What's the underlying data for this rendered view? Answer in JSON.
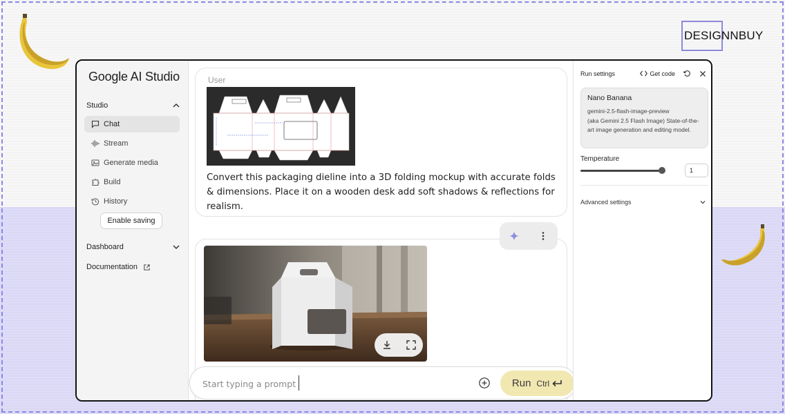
{
  "brand": {
    "label": "DESIGNNBUY"
  },
  "app": {
    "logo": "Google AI Studio"
  },
  "sidebar": {
    "studio_label": "Studio",
    "items": [
      {
        "label": "Chat",
        "icon": "chat-icon",
        "active": true
      },
      {
        "label": "Stream",
        "icon": "waveform-icon"
      },
      {
        "label": "Generate media",
        "icon": "media-icon"
      },
      {
        "label": "Build",
        "icon": "puzzle-icon"
      },
      {
        "label": "History",
        "icon": "history-icon"
      }
    ],
    "enable_saving": "Enable saving",
    "dashboard_label": "Dashboard",
    "documentation_label": "Documentation"
  },
  "chat": {
    "user_label": "User",
    "user_prompt": "Convert this packaging dieline into a 3D folding mockup with accurate folds & dimensions. Place it on a wooden desk add soft shadows & reflections for realism."
  },
  "prompt_bar": {
    "placeholder": "Start typing a prompt",
    "run_label": "Run",
    "shortcut": "Ctrl"
  },
  "settings": {
    "title": "Run settings",
    "get_code": "Get code",
    "model": {
      "name": "Nano Banana",
      "id": "gemini-2.5-flash-image-preview",
      "description": "(aka Gemini 2.5 Flash Image) State-of-the-art image generation and editing model."
    },
    "temperature_label": "Temperature",
    "temperature_value": "1",
    "temperature_level": 1.0,
    "advanced_label": "Advanced settings"
  },
  "colors": {
    "accent_run": "#f1e7b1",
    "frame_dashed": "#8a86e6",
    "lower_bg": "#dedcf7"
  }
}
